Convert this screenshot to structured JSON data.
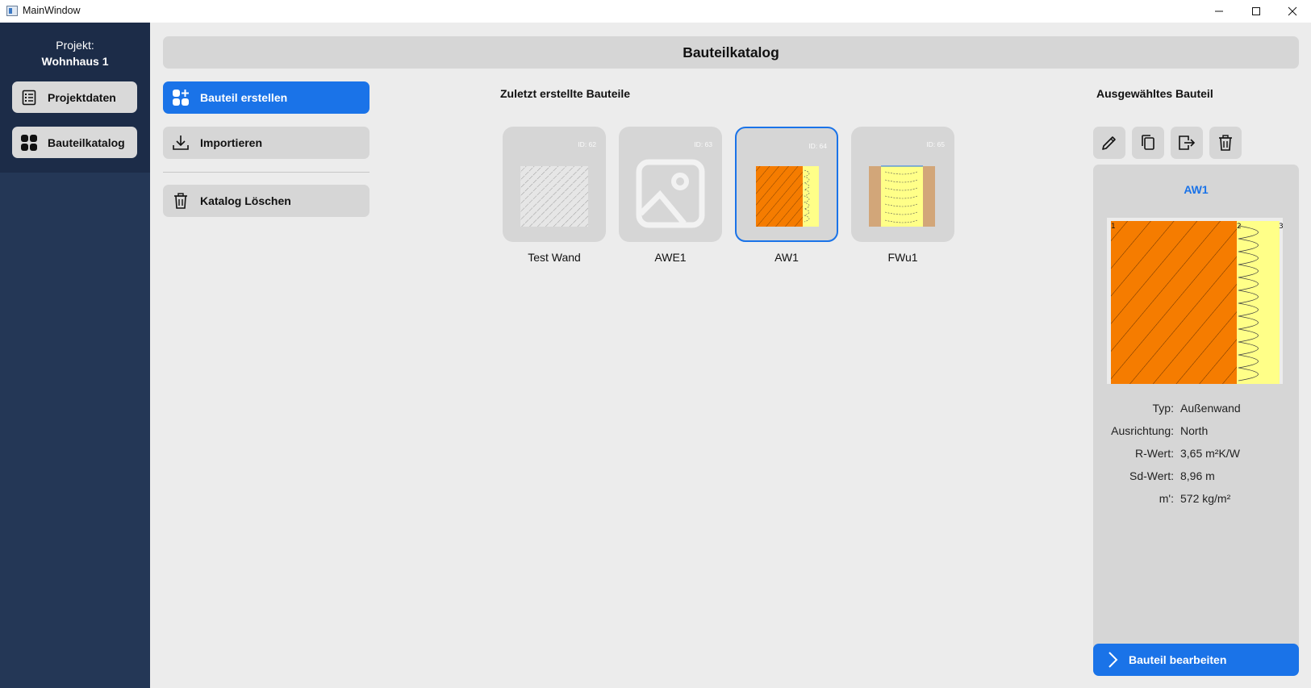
{
  "window": {
    "title": "MainWindow"
  },
  "sidebar": {
    "project_label": "Projekt:",
    "project_name": "Wohnhaus 1",
    "items": [
      {
        "label": "Projektdaten",
        "icon": "list-icon"
      },
      {
        "label": "Bauteilkatalog",
        "icon": "grid-icon"
      }
    ]
  },
  "header": {
    "title": "Bauteilkatalog"
  },
  "actions": {
    "create": "Bauteil erstellen",
    "import": "Importieren",
    "delete_catalog": "Katalog Löschen"
  },
  "recent": {
    "title": "Zuletzt erstellte Bauteile",
    "cards": [
      {
        "id": "ID: 62",
        "name": "Test Wand",
        "thumbnail": "hatched-wall"
      },
      {
        "id": "ID: 63",
        "name": "AWE1",
        "thumbnail": "image-placeholder"
      },
      {
        "id": "ID: 64",
        "name": "AW1",
        "thumbnail": "brick-insulation",
        "selected": true
      },
      {
        "id": "ID: 65",
        "name": "FWu1",
        "thumbnail": "wood-insulation"
      }
    ]
  },
  "selected": {
    "title": "Ausgewähltes Bauteil",
    "tools": [
      "pencil-icon",
      "copy-icon",
      "export-icon",
      "trash-icon"
    ],
    "name": "AW1",
    "layer_markers": [
      "1",
      "2",
      "3"
    ],
    "props": [
      {
        "key": "Typ:",
        "value": "Außenwand"
      },
      {
        "key": "Ausrichtung:",
        "value": "North"
      },
      {
        "key": "R-Wert:",
        "value": "3,65 m²K/W"
      },
      {
        "key": "Sd-Wert:",
        "value": "8,96 m"
      },
      {
        "key": "m':",
        "value": "572 kg/m²"
      }
    ],
    "edit_button": "Bauteil bearbeiten"
  },
  "colors": {
    "accent": "#1a73e8",
    "sidebar": "#243756",
    "sidebar_top": "#1c2c48",
    "brick": "#f57c00",
    "insulation": "#ffff88",
    "wood": "#d2a679"
  }
}
